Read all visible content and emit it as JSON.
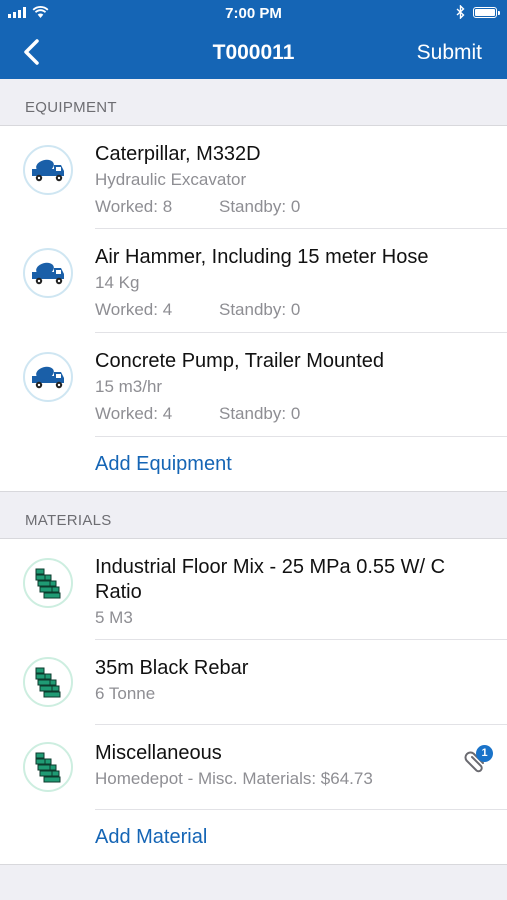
{
  "status": {
    "time": "7:00 PM"
  },
  "nav": {
    "title": "T000011",
    "submit_label": "Submit"
  },
  "equipment": {
    "header": "EQUIPMENT",
    "items": [
      {
        "name": "Caterpillar, M332D",
        "description": "Hydraulic Excavator",
        "worked": "Worked: 8",
        "standby": "Standby: 0"
      },
      {
        "name": "Air Hammer, Including 15 meter Hose",
        "description": "14 Kg",
        "worked": "Worked: 4",
        "standby": "Standby: 0"
      },
      {
        "name": "Concrete Pump, Trailer Mounted",
        "description": "15 m3/hr",
        "worked": "Worked: 4",
        "standby": "Standby: 0"
      }
    ],
    "add_label": "Add Equipment"
  },
  "materials": {
    "header": "MATERIALS",
    "items": [
      {
        "name": "Industrial Floor Mix - 25 MPa 0.55 W/ C Ratio",
        "quantity": "5 M3"
      },
      {
        "name": "35m Black Rebar",
        "quantity": "6 Tonne"
      },
      {
        "name": "Miscellaneous",
        "quantity": "Homedepot - Misc. Materials: $64.73",
        "attachment_count": "1"
      }
    ],
    "add_label": "Add Material"
  },
  "colors": {
    "nav_bg": "#1565b5",
    "link": "#1565b5",
    "badge": "#1a73c9"
  },
  "icons": {
    "equipment": "concrete-mixer-truck-icon",
    "material": "brick-wall-icon",
    "attachment": "paperclip-icon"
  }
}
